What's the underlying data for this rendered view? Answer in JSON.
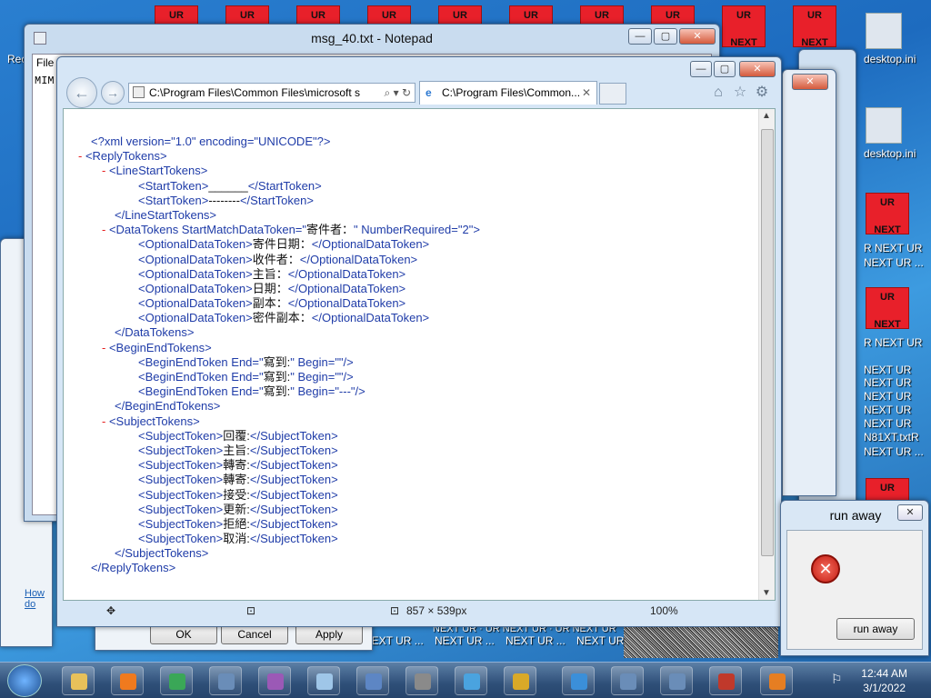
{
  "desktop": {
    "ur_icons": [
      {
        "t1": "UR",
        "t2": ""
      },
      {
        "t1": "UR",
        "t2": ""
      },
      {
        "t1": "UR",
        "t2": ""
      },
      {
        "t1": "UR",
        "t2": ""
      },
      {
        "t1": "UR",
        "t2": ""
      },
      {
        "t1": "UR",
        "t2": ""
      },
      {
        "t1": "UR",
        "t2": ""
      },
      {
        "t1": "UR",
        "t2": ""
      },
      {
        "t1": "UR",
        "t2": "NEXT"
      },
      {
        "t1": "UR",
        "t2": "NEXT"
      }
    ],
    "right_ur_icons": [
      {
        "t1": "UR",
        "t2": "NEXT"
      },
      {
        "t1": "UR",
        "t2": "NEXT"
      },
      {
        "t1": "UR",
        "t2": ""
      }
    ],
    "labels": {
      "recycle": "Rec",
      "desktop_ini_1": "desktop.ini",
      "desktop_ini_2": "desktop.ini",
      "right_stack": [
        "R NEXT UR",
        "NEXT UR ...",
        "R NEXT UR",
        "NEXT UR",
        "NEXT UR",
        "NEXT UR",
        "NEXT UR",
        "NEXT UR",
        "N81XT.txtR",
        "NEXT UR ..."
      ],
      "bottom_row": [
        "NEXT UR ...",
        "NEXT UR ...",
        "NEXT UR"
      ],
      "bottom_row_top": "NEXT UR · UR NEXT UR · UR NEXT UR"
    }
  },
  "notepad": {
    "title": "msg_40.txt - Notepad",
    "menu_file": "File",
    "content": "MIM"
  },
  "bg_dialog": {
    "link": "How do",
    "ok": "OK",
    "cancel": "Cancel",
    "apply": "Apply"
  },
  "ie": {
    "address": "C:\\Program Files\\Common Files\\microsoft s",
    "tab_title": "C:\\Program Files\\Common...",
    "status_size": "857 × 539px",
    "zoom": "100%",
    "xml_lines": [
      {
        "indent": 0,
        "marker": "",
        "tag": "<?xml version=\"1.0\" encoding=\"UNICODE\"?>",
        "value": "",
        "close": ""
      },
      {
        "indent": 0,
        "marker": "- ",
        "tag": "<ReplyTokens>",
        "value": "",
        "close": ""
      },
      {
        "indent": 1,
        "marker": "- ",
        "tag": "<LineStartTokens>",
        "value": "",
        "close": ""
      },
      {
        "indent": 2,
        "marker": "",
        "tag": "<StartToken>",
        "value": "______",
        "close": "</StartToken>"
      },
      {
        "indent": 2,
        "marker": "",
        "tag": "<StartToken>",
        "value": "--------",
        "close": "</StartToken>"
      },
      {
        "indent": 1,
        "marker": "",
        "tag": "</LineStartTokens>",
        "value": "",
        "close": ""
      },
      {
        "indent": 1,
        "marker": "- ",
        "tag": "<DataTokens StartMatchDataToken=\"",
        "value": "寄件者：",
        "close": "\" NumberRequired=\"2\">"
      },
      {
        "indent": 2,
        "marker": "",
        "tag": "<OptionalDataToken>",
        "value": "寄件日期：",
        "close": "</OptionalDataToken>"
      },
      {
        "indent": 2,
        "marker": "",
        "tag": "<OptionalDataToken>",
        "value": "收件者：",
        "close": "</OptionalDataToken>"
      },
      {
        "indent": 2,
        "marker": "",
        "tag": "<OptionalDataToken>",
        "value": "主旨：",
        "close": "</OptionalDataToken>"
      },
      {
        "indent": 2,
        "marker": "",
        "tag": "<OptionalDataToken>",
        "value": "日期：",
        "close": "</OptionalDataToken>"
      },
      {
        "indent": 2,
        "marker": "",
        "tag": "<OptionalDataToken>",
        "value": "副本：",
        "close": "</OptionalDataToken>"
      },
      {
        "indent": 2,
        "marker": "",
        "tag": "<OptionalDataToken>",
        "value": "密件副本：",
        "close": "</OptionalDataToken>"
      },
      {
        "indent": 1,
        "marker": "",
        "tag": "</DataTokens>",
        "value": "",
        "close": ""
      },
      {
        "indent": 1,
        "marker": "- ",
        "tag": "<BeginEndTokens>",
        "value": "",
        "close": ""
      },
      {
        "indent": 2,
        "marker": "",
        "tag": "<BeginEndToken End=\"",
        "value": "寫到:",
        "close": "\" Begin=\"\"/>"
      },
      {
        "indent": 2,
        "marker": "",
        "tag": "<BeginEndToken End=\"",
        "value": "寫到:",
        "close": "\" Begin=\"\"/>"
      },
      {
        "indent": 2,
        "marker": "",
        "tag": "<BeginEndToken End=\"",
        "value": "寫到:",
        "close": "\" Begin=\"---\"/>"
      },
      {
        "indent": 1,
        "marker": "",
        "tag": "</BeginEndTokens>",
        "value": "",
        "close": ""
      },
      {
        "indent": 1,
        "marker": "- ",
        "tag": "<SubjectTokens>",
        "value": "",
        "close": ""
      },
      {
        "indent": 2,
        "marker": "",
        "tag": "<SubjectToken>",
        "value": "回覆:",
        "close": "</SubjectToken>"
      },
      {
        "indent": 2,
        "marker": "",
        "tag": "<SubjectToken>",
        "value": "主旨:",
        "close": "</SubjectToken>"
      },
      {
        "indent": 2,
        "marker": "",
        "tag": "<SubjectToken>",
        "value": "轉寄:",
        "close": "</SubjectToken>"
      },
      {
        "indent": 2,
        "marker": "",
        "tag": "<SubjectToken>",
        "value": "轉寄:",
        "close": "</SubjectToken>"
      },
      {
        "indent": 2,
        "marker": "",
        "tag": "<SubjectToken>",
        "value": "接受:",
        "close": "</SubjectToken>"
      },
      {
        "indent": 2,
        "marker": "",
        "tag": "<SubjectToken>",
        "value": "更新:",
        "close": "</SubjectToken>"
      },
      {
        "indent": 2,
        "marker": "",
        "tag": "<SubjectToken>",
        "value": "拒絕:",
        "close": "</SubjectToken>"
      },
      {
        "indent": 2,
        "marker": "",
        "tag": "<SubjectToken>",
        "value": "取消:",
        "close": "</SubjectToken>"
      },
      {
        "indent": 1,
        "marker": "",
        "tag": "</SubjectTokens>",
        "value": "",
        "close": ""
      },
      {
        "indent": 0,
        "marker": "",
        "tag": "</ReplyTokens>",
        "value": "",
        "close": ""
      }
    ]
  },
  "run_away": {
    "title": "run away",
    "button": "run away"
  },
  "taskbar": {
    "time": "12:44 AM",
    "date": "3/1/2022"
  },
  "colors": {
    "tag_blue": "#1f3ca8",
    "marker_red": "#e52020",
    "ur_red": "#e8202a"
  }
}
